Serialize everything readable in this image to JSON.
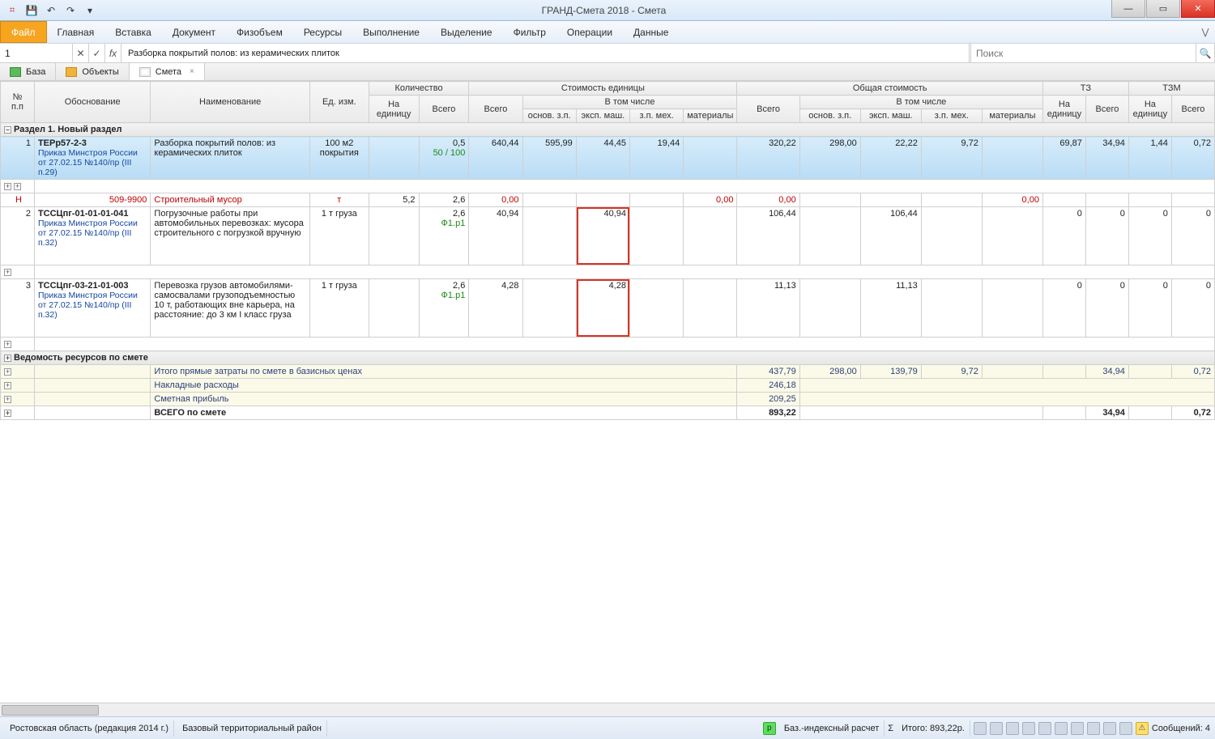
{
  "window": {
    "title": "ГРАНД-Смета 2018 - Смета",
    "qat_save": "💾",
    "qat_undo": "↶",
    "qat_redo": "↷",
    "qat_more": "▾"
  },
  "ribbon": {
    "file": "Файл",
    "tabs": [
      "Главная",
      "Вставка",
      "Документ",
      "Физобъем",
      "Ресурсы",
      "Выполнение",
      "Выделение",
      "Фильтр",
      "Операции",
      "Данные"
    ],
    "collapse": "⋁"
  },
  "formulabar": {
    "cell": "1",
    "cancel": "✕",
    "accept": "✓",
    "fx": "fx",
    "formula": "Разборка покрытий полов: из керамических плиток",
    "search_placeholder": "Поиск",
    "search_icon": "🔍"
  },
  "doctabs": {
    "db": "База",
    "objects": "Объекты",
    "active": "Смета",
    "close": "×"
  },
  "headers": {
    "num": "№\nп.п",
    "obos": "Обоснование",
    "name": "Наименование",
    "ed": "Ед. изм.",
    "qty_grp": "Количество",
    "qty_unit": "На\nединицу",
    "qty_total": "Всего",
    "su_grp": "Стоимость единицы",
    "total": "Всего",
    "vtch": "В том числе",
    "oz": "основ. з.п.",
    "em": "эксп. маш.",
    "zm": "з.п. мех.",
    "mat": "материалы",
    "os_grp": "Общая стоимость",
    "tz": "ТЗ",
    "tzm": "ТЗМ"
  },
  "section1": "Раздел 1. Новый раздел",
  "rows": [
    {
      "n": "1",
      "code": "ТЕРр57-2-3",
      "src": "Приказ Минстроя России от 27.02.15 №140/пр (III п.29)",
      "name": "Разборка покрытий полов: из керамических плиток",
      "ed": "100 м2 покрытия",
      "qu": "0,5",
      "qu2": "50 / 100",
      "st": "640,44",
      "oz": "595,99",
      "em": "44,45",
      "zm": "19,44",
      "mat": "",
      "ov": "320,22",
      "ooz": "298,00",
      "oem": "22,22",
      "ozm": "9,72",
      "omat": "",
      "tz1": "69,87",
      "tz2": "34,94",
      "tzm1": "1,44",
      "tzm2": "0,72"
    },
    {
      "n": "H",
      "code": "509-9900",
      "name": "Строительный мусор",
      "ed": "т",
      "qu": "5,2",
      "qt": "2,6",
      "st": "0,00",
      "ov": "0,00",
      "ooz": "0,00",
      "omat": "0,00"
    },
    {
      "n": "2",
      "code": "ТССЦпг-01-01-01-041",
      "src": "Приказ Минстроя России от 27.02.15 №140/пр (III п.32)",
      "name": "Погрузочные работы при автомобильных перевозках: мусора строительного с погрузкой вручную",
      "ed": "1 т груза",
      "qt": "2,6",
      "qt2": "Ф1.р1",
      "st": "40,94",
      "em": "40,94",
      "ov": "106,44",
      "oem": "106,44",
      "tz1": "0",
      "tz2": "0",
      "tzm1": "0",
      "tzm2": "0"
    },
    {
      "n": "3",
      "code": "ТССЦпг-03-21-01-003",
      "src": "Приказ Минстроя России от 27.02.15 №140/пр (III п.32)",
      "name": "Перевозка грузов автомобилями-самосвалами грузоподъемностью 10 т, работающих вне карьера, на расстояние: до 3 км I класс груза",
      "ed": "1 т груза",
      "qt": "2,6",
      "qt2": "Ф1.р1",
      "st": "4,28",
      "em": "4,28",
      "ov": "11,13",
      "oem": "11,13",
      "tz1": "0",
      "tz2": "0",
      "tzm1": "0",
      "tzm2": "0"
    }
  ],
  "footer_section": "Ведомость ресурсов по смете",
  "sums": [
    {
      "name": "Итого прямые затраты по смете в базисных ценах",
      "ov": "437,79",
      "ooz": "298,00",
      "oem": "139,79",
      "ozm": "9,72",
      "tz2": "34,94",
      "tzm2": "0,72"
    },
    {
      "name": "Накладные расходы",
      "ov": "246,18"
    },
    {
      "name": "Сметная прибыль",
      "ov": "209,25"
    }
  ],
  "total": {
    "name": "ВСЕГО по смете",
    "ov": "893,22",
    "tz2": "34,94",
    "tzm2": "0,72"
  },
  "statusbar": {
    "region": "Ростовская область (редакция 2014 г.)",
    "territory": "Базовый территориальный район",
    "calc": "Баз.-индексный расчет",
    "sum_lbl": "Σ",
    "sum": "Итого: 893,22р.",
    "msgs": "Сообщений: 4"
  }
}
